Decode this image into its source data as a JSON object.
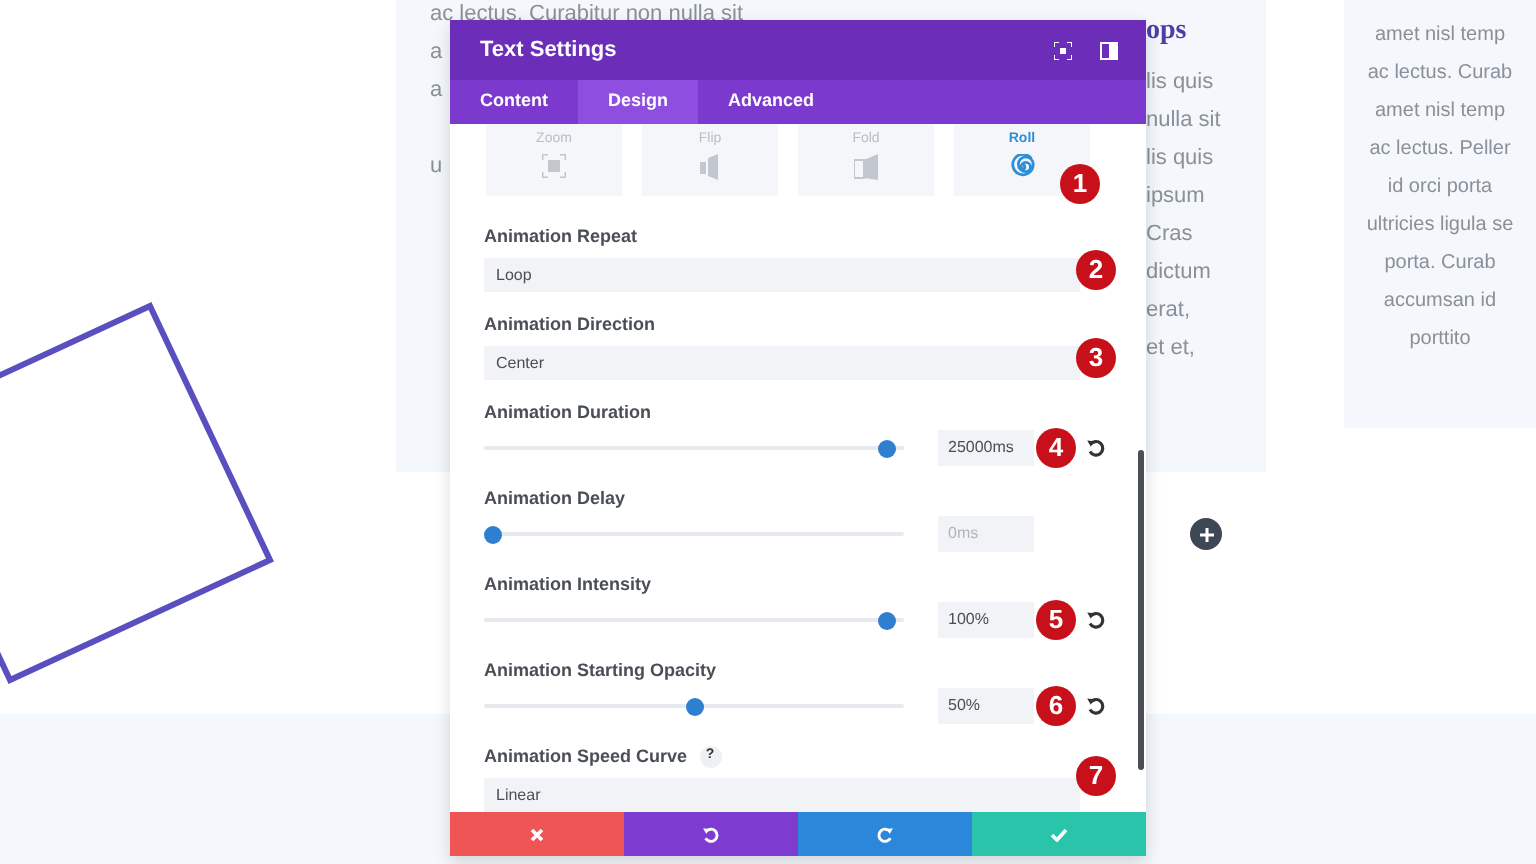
{
  "background": {
    "card_left_lines": [
      "ac lectus. Curabitur non nulla sit",
      "a",
      "a",
      "u"
    ],
    "card_right_heading": "ops",
    "card_right_lines": [
      "lis quis",
      "nulla sit",
      "lis quis",
      "ipsum",
      "Cras",
      "dictum",
      "erat,",
      "et et,"
    ],
    "side_card_lines": [
      "amet nisl temp",
      "ac lectus. Curab",
      "amet nisl temp",
      "ac lectus. Peller",
      "id orci porta",
      "ultricies ligula se",
      "porta. Curab",
      "accumsan id",
      "porttito"
    ]
  },
  "modal": {
    "title": "Text Settings",
    "tabs": [
      {
        "label": "Content",
        "selected": false
      },
      {
        "label": "Design",
        "selected": true
      },
      {
        "label": "Advanced",
        "selected": false
      }
    ],
    "styles": [
      {
        "label": "Zoom",
        "selected": false
      },
      {
        "label": "Flip",
        "selected": false
      },
      {
        "label": "Fold",
        "selected": false
      },
      {
        "label": "Roll",
        "selected": true
      }
    ],
    "styles_marker": "1",
    "fields": [
      {
        "kind": "select",
        "label": "Animation Repeat",
        "value": "Loop",
        "marker": "2"
      },
      {
        "kind": "select",
        "label": "Animation Direction",
        "value": "Center",
        "marker": "3"
      },
      {
        "kind": "slider",
        "label": "Animation Duration",
        "value": "25000ms",
        "level": 0.98,
        "reset": true,
        "marker": "4"
      },
      {
        "kind": "slider",
        "label": "Animation Delay",
        "placeholder": "0ms",
        "level": 0,
        "reset": false
      },
      {
        "kind": "slider",
        "label": "Animation Intensity",
        "value": "100%",
        "level": 0.98,
        "reset": true,
        "marker": "5"
      },
      {
        "kind": "slider",
        "label": "Animation Starting Opacity",
        "value": "50%",
        "level": 0.5,
        "reset": true,
        "marker": "6"
      },
      {
        "kind": "select",
        "label": "Animation Speed Curve",
        "help": "?",
        "value": "Linear",
        "marker": "7"
      }
    ]
  }
}
